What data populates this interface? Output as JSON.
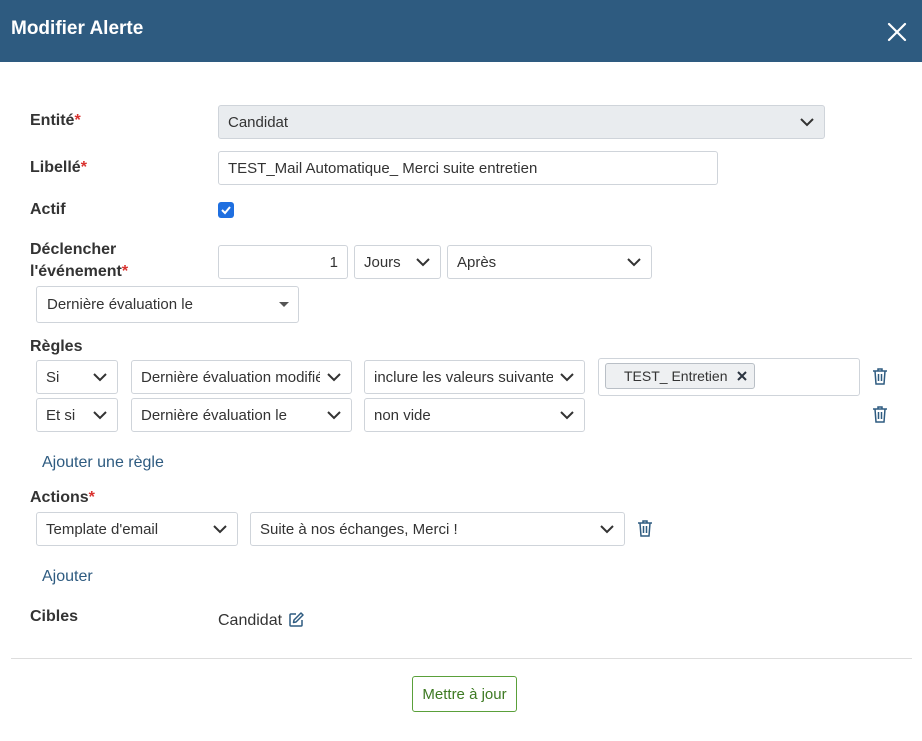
{
  "header": {
    "title": "Modifier Alerte",
    "close_icon": "close-icon"
  },
  "form": {
    "entity": {
      "label": "Entité",
      "required_mark": "*",
      "value": "Candidat"
    },
    "libelle": {
      "label": "Libellé",
      "required_mark": "*",
      "value": "TEST_Mail Automatique_ Merci suite entretien"
    },
    "actif": {
      "label": "Actif",
      "checked": true
    },
    "trigger": {
      "label_line1": "Déclencher",
      "label_line2": "l'événement",
      "required_mark": "*",
      "amount": "1",
      "unit": "Jours",
      "when": "Après",
      "field": "Dernière évaluation le"
    },
    "rules": {
      "label": "Règles",
      "items": [
        {
          "connector": "Si",
          "field": "Dernière évaluation modifiée",
          "operator": "inclure les valeurs suivantes",
          "tags": [
            "TEST_ Entretien"
          ]
        },
        {
          "connector": "Et si",
          "field": "Dernière évaluation le",
          "operator": "non vide"
        }
      ],
      "add_label": "Ajouter une règle"
    },
    "actions": {
      "label": "Actions",
      "required_mark": "*",
      "items": [
        {
          "type": "Template d'email",
          "template": "Suite à nos échanges, Merci !"
        }
      ],
      "add_label": "Ajouter"
    },
    "targets": {
      "label": "Cibles",
      "value": "Candidat"
    }
  },
  "footer": {
    "submit_label": "Mettre à jour"
  },
  "colors": {
    "header_bg": "#2e5b80",
    "required": "#d9322f",
    "checkbox": "#1f6fe0",
    "submit_border": "#5aa03a",
    "link": "#2e5b80"
  }
}
